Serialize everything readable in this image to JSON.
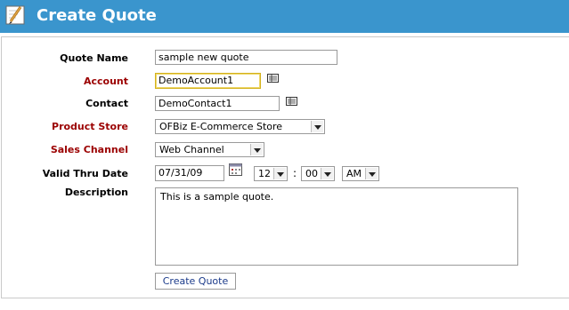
{
  "header": {
    "title": "Create Quote",
    "icon": "pencil-notepad-icon",
    "bg_color": "#3a95cd"
  },
  "form": {
    "quote_name": {
      "label": "Quote Name",
      "value": "sample new quote"
    },
    "account": {
      "label": "Account",
      "value": "DemoAccount1",
      "required": true
    },
    "contact": {
      "label": "Contact",
      "value": "DemoContact1"
    },
    "product_store": {
      "label": "Product Store",
      "value": "OFBiz E-Commerce Store",
      "required": true
    },
    "sales_channel": {
      "label": "Sales Channel",
      "value": "Web Channel",
      "required": true
    },
    "valid_thru": {
      "label": "Valid Thru Date",
      "date": "07/31/09",
      "hour": "12",
      "minute": "00",
      "ampm": "AM",
      "separator": ":"
    },
    "description": {
      "label": "Description",
      "value": "This is a sample quote."
    },
    "submit_label": "Create Quote"
  },
  "colors": {
    "required_label": "#9b0000",
    "button_text": "#1a3a8a"
  }
}
